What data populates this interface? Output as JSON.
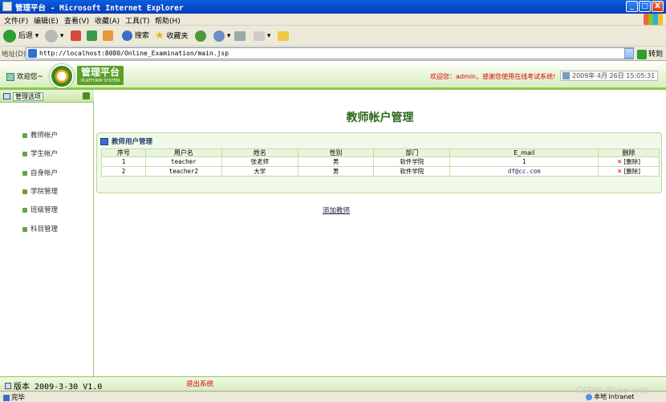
{
  "window": {
    "title": "管理平台 - Microsoft Internet Explorer",
    "buttons": {
      "minimize": "_",
      "maximize": "□",
      "close": "X"
    }
  },
  "menu": [
    "文件(F)",
    "编辑(E)",
    "查看(V)",
    "收藏(A)",
    "工具(T)",
    "帮助(H)"
  ],
  "toolbar": {
    "back": "后退",
    "search": "搜索",
    "favorites": "收藏夹"
  },
  "address": {
    "label": "地址(D)",
    "url": "http://localhost:8080/Online_Examination/main.jsp",
    "go": "转到"
  },
  "header": {
    "welcome": "欢迎您~",
    "logo_title": "管理平台",
    "logo_subtitle": "PLATFORM SYSTEM",
    "marquee": "欢迎您：admin，感谢您使用在线考试系统!",
    "datetime": "2009年 4月 26日 15:05:31"
  },
  "sidebar": {
    "title": "管理选项",
    "items": [
      "教师帐户",
      "学生帐户",
      "自身帐户",
      "学院管理",
      "班级管理",
      "科目管理"
    ]
  },
  "main": {
    "title": "教师帐户管理",
    "panel_title": "教师用户管理",
    "columns": [
      "序号",
      "用户名",
      "姓名",
      "性别",
      "部门",
      "E_mail",
      "删除"
    ],
    "rows": [
      [
        "1",
        "teacher",
        "张老师",
        "男",
        "软件学院",
        "1",
        "[删除]"
      ],
      [
        "2",
        "teacher2",
        "大学",
        "男",
        "软件学院",
        "df@cc.com",
        "[删除]"
      ]
    ],
    "add_link": "添加教师"
  },
  "footer": {
    "version": "版本 2009-3-30 V1.0",
    "logout": "退出系统"
  },
  "status": {
    "text": "完毕",
    "zone": "本地 Intranet"
  },
  "watermark": "CSDN @Lee-web",
  "colors": {
    "accent": "#8cc84b",
    "title": "#2c6a1c",
    "alert": "#dd0000"
  }
}
